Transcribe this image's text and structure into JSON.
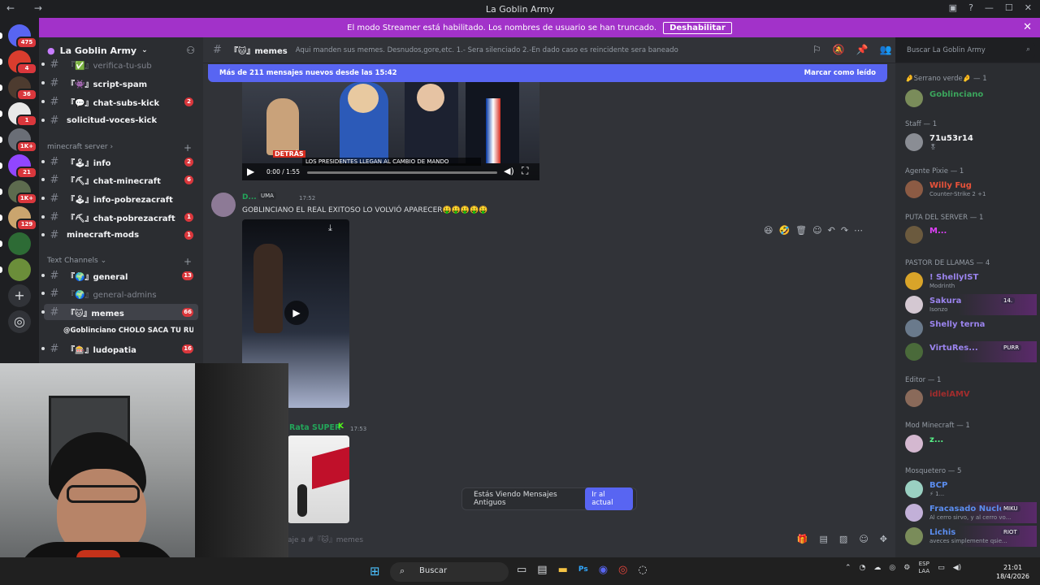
{
  "window": {
    "title": "La Goblin Army"
  },
  "banner": {
    "text": "El modo Streamer está habilitado. Los nombres de usuario se han truncado.",
    "button": "Deshabilitar"
  },
  "servers": [
    {
      "badge": "475"
    },
    {
      "badge": "4"
    },
    {
      "badge": "36"
    },
    {
      "badge": "1"
    },
    {
      "badge": "1K+"
    },
    {
      "badge": "21"
    },
    {
      "badge": "1K+"
    },
    {
      "badge": "129"
    },
    {
      "badge": ""
    },
    {
      "badge": ""
    }
  ],
  "sidebar": {
    "server_name": "La Goblin Army",
    "channels_top": [
      {
        "name": "『✅』verifica-tu-sub",
        "count": "",
        "dim": true
      },
      {
        "name": "『👾』script-spam",
        "count": ""
      },
      {
        "name": "『💬』chat-subs-kick",
        "count": "2"
      },
      {
        "name": "solicitud-voces-kick",
        "count": ""
      }
    ],
    "cat_minecraft": "minecraft server",
    "channels_mc": [
      {
        "name": "『🕹』info",
        "count": "2"
      },
      {
        "name": "『⛏』chat-minecraft",
        "count": "6"
      },
      {
        "name": "『🕹』info-pobrezacraft",
        "count": ""
      },
      {
        "name": "『⛏』chat-pobrezacraft",
        "count": "1"
      },
      {
        "name": "minecraft-mods",
        "count": "1"
      }
    ],
    "cat_text": "Text Channels",
    "channels_text": [
      {
        "name": "『🌍』general",
        "count": "13"
      },
      {
        "name": "『🌍』general-admins",
        "count": "",
        "dim": true
      },
      {
        "name": "『🐱』memes",
        "count": "66"
      }
    ],
    "thread": "@Goblinciano CHOLO SACA TU RUE...",
    "channels_last": [
      {
        "name": "『🎰』ludopatia",
        "count": "16"
      }
    ]
  },
  "header": {
    "channel": "『🐱』memes",
    "topic": "Aqui manden sus memes. Desnudos,gore,etc. 1.- Sera silenciado 2.-En dado caso es reincidente sera baneado",
    "search_placeholder": "Buscar La Goblin Army"
  },
  "newbar": {
    "text": "Más de 211 mensajes nuevos desde las 15:42",
    "action": "Marcar como leído"
  },
  "video1": {
    "caption": "LOS PRESIDENTES LLEGAN AL CAMBIO DE MANDO",
    "time": "0:00 / 1:55",
    "overlay": "DETRÁS"
  },
  "message1": {
    "author": "D...",
    "tag": "UMA",
    "time": "17:52",
    "text": "GOBLINCIANO EL REAL EXITOSO LO VOLVIÓ APARECER🤑🤑🤑🤑🤑"
  },
  "message2": {
    "author": "Rata SUPER",
    "time": "17:53"
  },
  "old_messages": {
    "text": "Estás Viendo Mensajes Antiguos",
    "button": "Ir al actual"
  },
  "composer": {
    "placeholder": "aje a #『🐱』memes"
  },
  "members": {
    "groups": [
      {
        "role": "🤌Serrano verde🤌 — 1",
        "members": [
          {
            "name": "Goblinciano",
            "status": "",
            "color": "#3ba55c"
          }
        ]
      },
      {
        "role": "Staff — 1",
        "members": [
          {
            "name": "71u53r14",
            "status": "🎖",
            "color": "#f2f3f5"
          }
        ]
      },
      {
        "role": "Agente Pixie — 1",
        "members": [
          {
            "name": "Willy Fug",
            "status": "Counter-Strike 2 +1",
            "color": "#e8523a"
          }
        ]
      },
      {
        "role": "PUTA DEL SERVER — 1",
        "members": [
          {
            "name": "M...",
            "status": "",
            "color": "#e040fb"
          }
        ]
      },
      {
        "role": "PASTOR DE LLAMAS — 4",
        "members": [
          {
            "name": "! ShellyIST",
            "status": "Modrinth",
            "color": "#9b84ee"
          },
          {
            "name": "Sakura",
            "status": "Isonzo",
            "color": "#9b84ee",
            "tag": "14."
          },
          {
            "name": "Shelly terna",
            "status": "",
            "color": "#9b84ee"
          },
          {
            "name": "VirtuRes...",
            "status": "",
            "color": "#9b84ee",
            "tag": "PURR"
          }
        ]
      },
      {
        "role": "Editor — 1",
        "members": [
          {
            "name": "idlelAMV",
            "status": "",
            "color": "#a12d2d"
          }
        ]
      },
      {
        "role": "Mod Minecraft — 1",
        "members": [
          {
            "name": "z...",
            "status": "",
            "color": "#57f287"
          }
        ]
      },
      {
        "role": "Mosquetero — 5",
        "members": [
          {
            "name": "BCP",
            "status": "⚡ 1...",
            "color": "#5b8def"
          },
          {
            "name": "Fracasado Nuclear",
            "status": "Al cerro sirvo, y al cerro vo...",
            "color": "#5b8def",
            "tag": "MIKU"
          },
          {
            "name": "Lichis",
            "status": "aveces simplemente qsie...",
            "color": "#5b8def",
            "tag": "RIOT"
          }
        ]
      }
    ]
  },
  "taskbar": {
    "search": "Buscar",
    "lang": "ESP\nLAA",
    "time": "21:01",
    "date": "18/4/2026"
  },
  "colors": {
    "accent": "#5865f2",
    "banner": "#a232c9",
    "badge": "#da373c"
  }
}
